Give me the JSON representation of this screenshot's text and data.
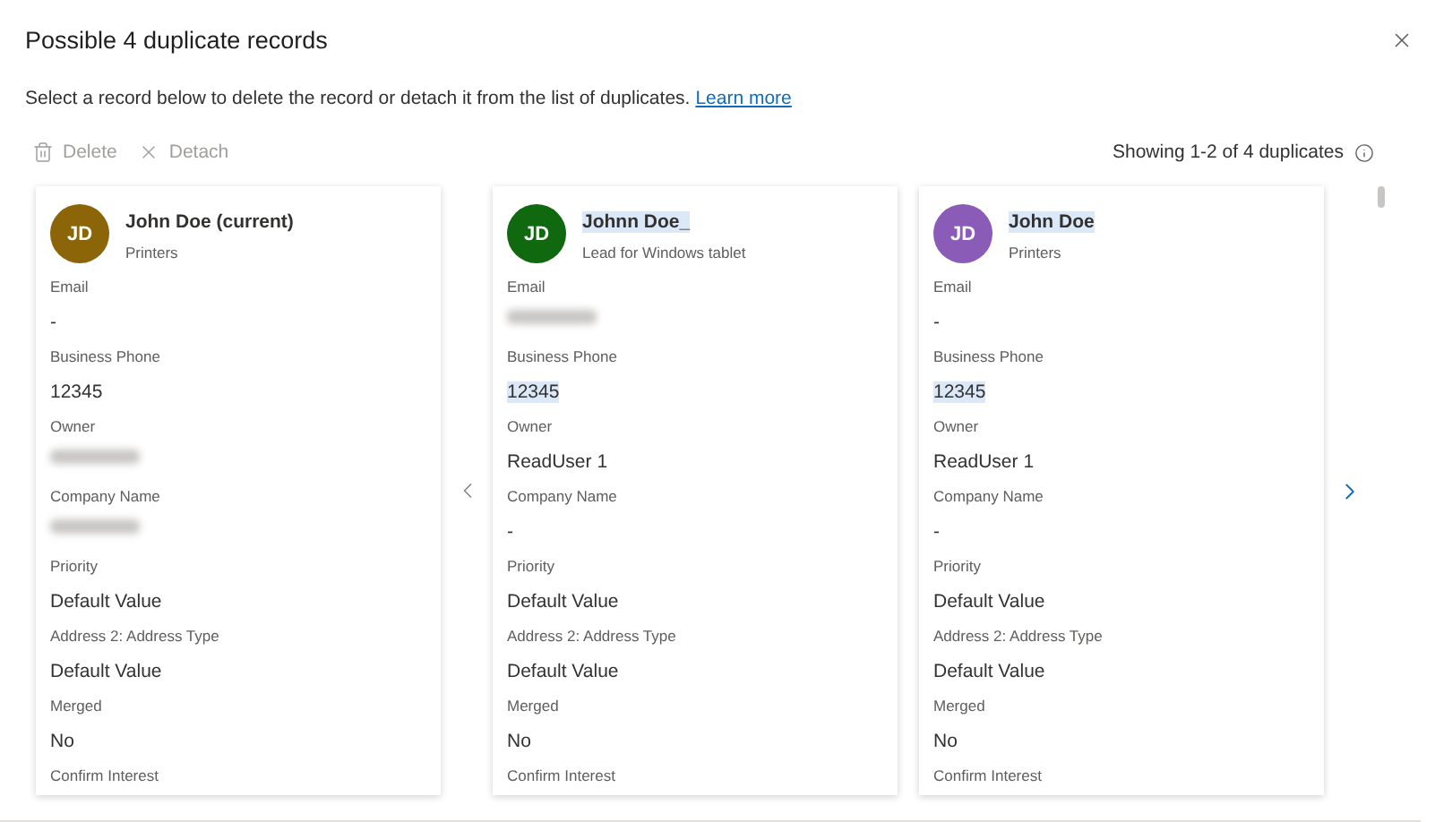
{
  "dialog": {
    "title": "Possible 4 duplicate records",
    "description": "Select a record below to delete the record or detach it from the list of duplicates.",
    "learn_more": "Learn more"
  },
  "toolbar": {
    "actions": [
      {
        "kind": "delete",
        "label": "Delete",
        "disabled": true
      },
      {
        "kind": "detach",
        "label": "Detach",
        "disabled": true
      }
    ],
    "count": "Showing 1-2 of 4 duplicates"
  },
  "records": [
    {
      "initials": "JD",
      "color": "#8b6508",
      "name": "John Doe (current)",
      "subtitle": "Printers",
      "highlighted": false,
      "fields": [
        {
          "label": "Email",
          "value": "-",
          "kind": "text",
          "highlighted": false
        },
        {
          "label": "Business Phone",
          "value": "12345",
          "kind": "text",
          "highlighted": false
        },
        {
          "label": "Owner",
          "kind": "redacted"
        },
        {
          "label": "Company Name",
          "kind": "redacted"
        },
        {
          "label": "Priority",
          "value": "Default Value",
          "kind": "text",
          "highlighted": false
        },
        {
          "label": "Address 2: Address Type",
          "value": "Default Value",
          "kind": "text",
          "highlighted": false
        },
        {
          "label": "Merged",
          "value": "No",
          "kind": "text",
          "highlighted": false
        },
        {
          "label": "Confirm Interest",
          "kind": "label_only"
        }
      ]
    },
    {
      "initials": "JD",
      "color": "#10680f",
      "name": "Johnn Doe_",
      "subtitle": "Lead for Windows tablet",
      "highlighted": true,
      "fields": [
        {
          "label": "Email",
          "kind": "redacted"
        },
        {
          "label": "Business Phone",
          "value": "12345",
          "kind": "text",
          "highlighted": true
        },
        {
          "label": "Owner",
          "value": "ReadUser 1",
          "kind": "text",
          "highlighted": false
        },
        {
          "label": "Company Name",
          "value": "-",
          "kind": "text",
          "highlighted": false
        },
        {
          "label": "Priority",
          "value": "Default Value",
          "kind": "text",
          "highlighted": false
        },
        {
          "label": "Address 2: Address Type",
          "value": "Default Value",
          "kind": "text",
          "highlighted": false
        },
        {
          "label": "Merged",
          "value": "No",
          "kind": "text",
          "highlighted": false
        },
        {
          "label": "Confirm Interest",
          "kind": "label_only"
        }
      ]
    },
    {
      "initials": "JD",
      "color": "#8a5cb8",
      "name": "John Doe",
      "subtitle": "Printers",
      "highlighted": true,
      "fields": [
        {
          "label": "Email",
          "value": "-",
          "kind": "text",
          "highlighted": false
        },
        {
          "label": "Business Phone",
          "value": "12345",
          "kind": "text",
          "highlighted": true
        },
        {
          "label": "Owner",
          "value": "ReadUser 1",
          "kind": "text",
          "highlighted": false
        },
        {
          "label": "Company Name",
          "value": "-",
          "kind": "text",
          "highlighted": false
        },
        {
          "label": "Priority",
          "value": "Default Value",
          "kind": "text",
          "highlighted": false
        },
        {
          "label": "Address 2: Address Type",
          "value": "Default Value",
          "kind": "text",
          "highlighted": false
        },
        {
          "label": "Merged",
          "value": "No",
          "kind": "text",
          "highlighted": false
        },
        {
          "label": "Confirm Interest",
          "kind": "label_only"
        }
      ]
    }
  ]
}
